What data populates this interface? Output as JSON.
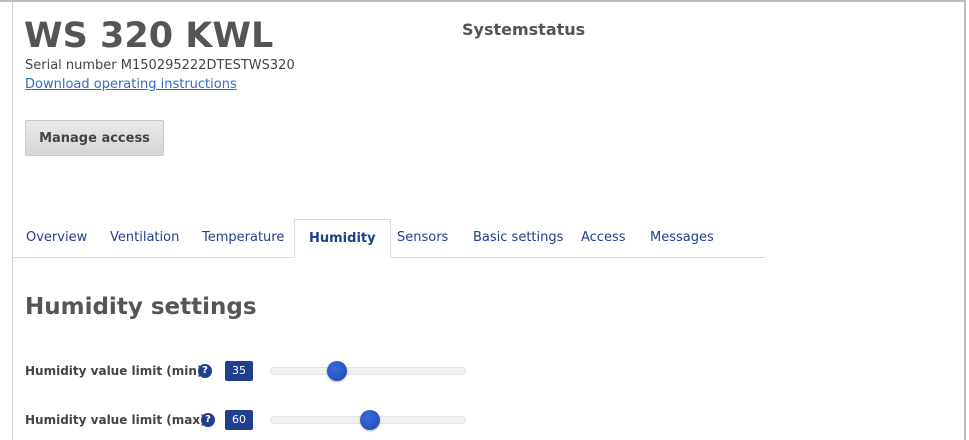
{
  "device": {
    "title": "WS 320 KWL",
    "serial_text": "Serial number M150295222DTESTWS320",
    "download_link": "Download operating instructions",
    "system_status": "Systemstatus"
  },
  "actions": {
    "manage_access": "Manage access"
  },
  "tabs": [
    {
      "label": "Overview"
    },
    {
      "label": "Ventilation"
    },
    {
      "label": "Temperature"
    },
    {
      "label": "Humidity",
      "active": true
    },
    {
      "label": "Sensors"
    },
    {
      "label": "Basic settings"
    },
    {
      "label": "Access"
    },
    {
      "label": "Messages"
    }
  ],
  "section": {
    "heading": "Humidity settings"
  },
  "settings": [
    {
      "label": "Humidity value limit (min)",
      "help_icon": "question-circle-icon",
      "value": "35",
      "slider_fraction": 0.34
    },
    {
      "label": "Humidity value limit (max)",
      "help_icon": "question-circle-icon",
      "value": "60",
      "slider_fraction": 0.51
    }
  ],
  "colors": {
    "accent": "#1f3f8f",
    "link": "#2f6fbf",
    "heading": "#555555"
  }
}
